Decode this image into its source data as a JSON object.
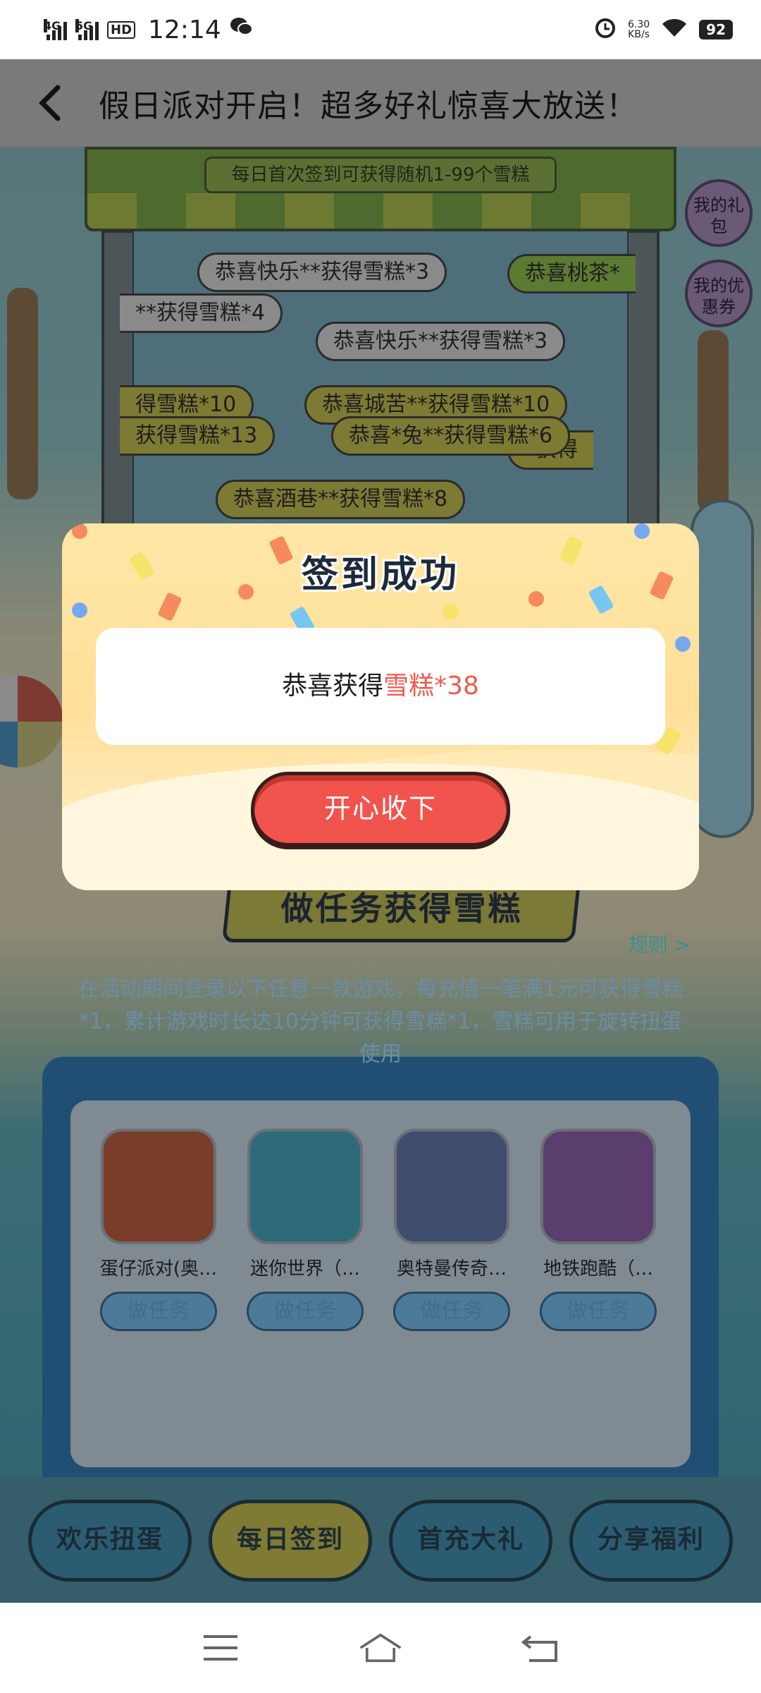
{
  "status_bar": {
    "network1": "4G",
    "network2": "5G",
    "hd": "HD",
    "time": "12:14",
    "speed_value": "6.30",
    "speed_unit": "KB/s",
    "battery": "92"
  },
  "header": {
    "title": "假日派对开启！超多好礼惊喜大放送！"
  },
  "stall": {
    "banner": "每日首次签到可获得随机1-99个雪糕",
    "messages": [
      "恭喜快乐**获得雪糕*3",
      "恭喜桃茶*",
      "**获得雪糕*4",
      "恭喜快乐**获得雪糕*3",
      "得雪糕*10",
      "恭喜城苦**获得雪糕*10",
      "获得雪糕*13",
      "恭喜*兔**获得雪糕*6",
      "*获得",
      "恭喜酒巷**获得雪糕*8"
    ]
  },
  "side_buttons": [
    {
      "label": "我的礼包"
    },
    {
      "label": "我的优惠券"
    }
  ],
  "tasks": {
    "title": "做任务获得雪糕",
    "rules_link": "规则 >",
    "description": "在活动期间登录以下任意一款游戏，每充值一笔满1元可获得雪糕*1，累计游戏时长达10分钟可获得雪糕*1，雪糕可用于旋转扭蛋使用",
    "games": [
      {
        "name": "蛋仔派对(奥…",
        "button": "做任务",
        "color": "#7a3d2a"
      },
      {
        "name": "迷你世界（…",
        "button": "做任务",
        "color": "#2f6a7a"
      },
      {
        "name": "奥特曼传奇…",
        "button": "做任务",
        "color": "#3f4e6e"
      },
      {
        "name": "地铁跑酷（…",
        "button": "做任务",
        "color": "#5a3f6e"
      }
    ]
  },
  "bottom_tabs": [
    {
      "label": "欢乐扭蛋",
      "active": false
    },
    {
      "label": "每日签到",
      "active": true
    },
    {
      "label": "首充大礼",
      "active": false
    },
    {
      "label": "分享福利",
      "active": false
    }
  ],
  "modal": {
    "title": "签到成功",
    "reward_prefix": "恭喜获得",
    "reward_item": "雪糕*38",
    "confirm_label": "开心收下"
  },
  "colors": {
    "accent": "#f0544d",
    "modal_bg": "#ffe7a6",
    "highlight": "#ef5a4e"
  }
}
